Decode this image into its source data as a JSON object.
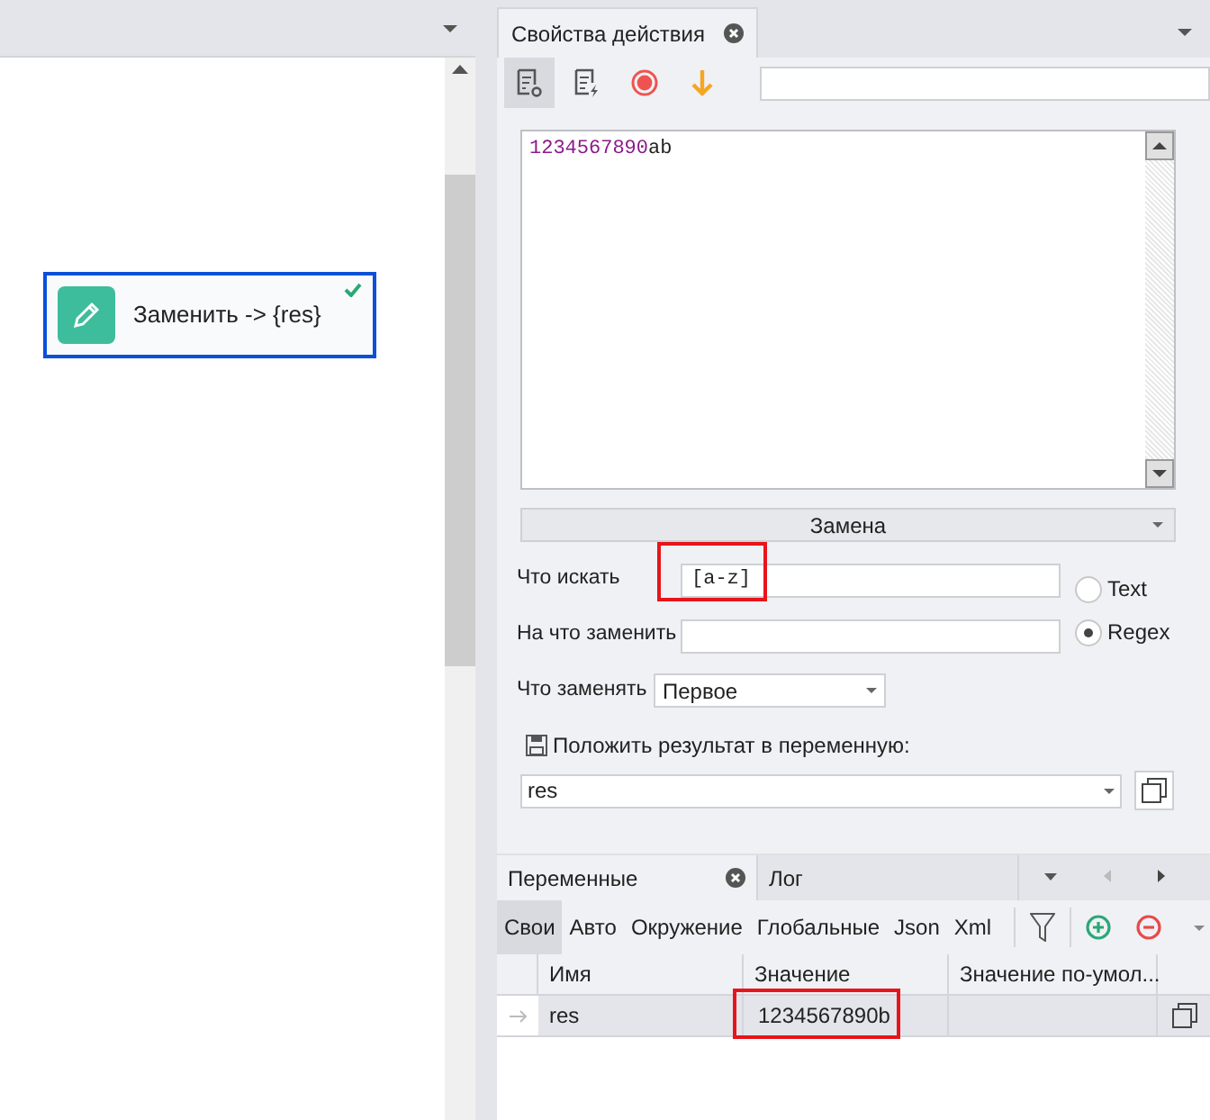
{
  "canvas": {
    "node": {
      "label": "Заменить -> {res}",
      "done": true,
      "selected": true
    }
  },
  "properties_tab": {
    "title": "Свойства действия"
  },
  "toolbar": [
    {
      "kind": "settings-doc",
      "selected": true
    },
    {
      "kind": "action-doc",
      "selected": false
    },
    {
      "kind": "record",
      "selected": false
    },
    {
      "kind": "down",
      "selected": false
    }
  ],
  "text_input": {
    "digits": "1234567890",
    "letters": "ab"
  },
  "mode_dropdown": {
    "value": "Замена"
  },
  "fields": [
    {
      "label": "Что искать",
      "value": "[a-z]",
      "highlighted": true
    },
    {
      "label": "На что заменить",
      "highlighted": false
    }
  ],
  "radios": [
    {
      "label": "Text",
      "selected": false
    },
    {
      "label": "Regex",
      "selected": true
    }
  ],
  "replace_which": {
    "label": "Что заменять",
    "value": "Первое"
  },
  "result": {
    "label": "Положить результат в переменную:",
    "value": "res"
  },
  "bottom_tabs": [
    {
      "label": "Переменные",
      "selected": true,
      "closable": true
    },
    {
      "label": "Лог",
      "selected": false,
      "closable": false
    }
  ],
  "filters": [
    {
      "label": "Свои",
      "selected": true
    },
    {
      "label": "Авто",
      "selected": false
    },
    {
      "label": "Окружение",
      "selected": false
    },
    {
      "label": "Глобальные",
      "selected": false
    },
    {
      "label": "Json",
      "selected": false
    },
    {
      "label": "Xml",
      "selected": false
    }
  ],
  "table": {
    "columns": [
      "Имя",
      "Значение",
      "Значение по-умол..."
    ],
    "rows": [
      {
        "name": "res",
        "value": "1234567890b",
        "value_highlighted": true
      }
    ]
  }
}
